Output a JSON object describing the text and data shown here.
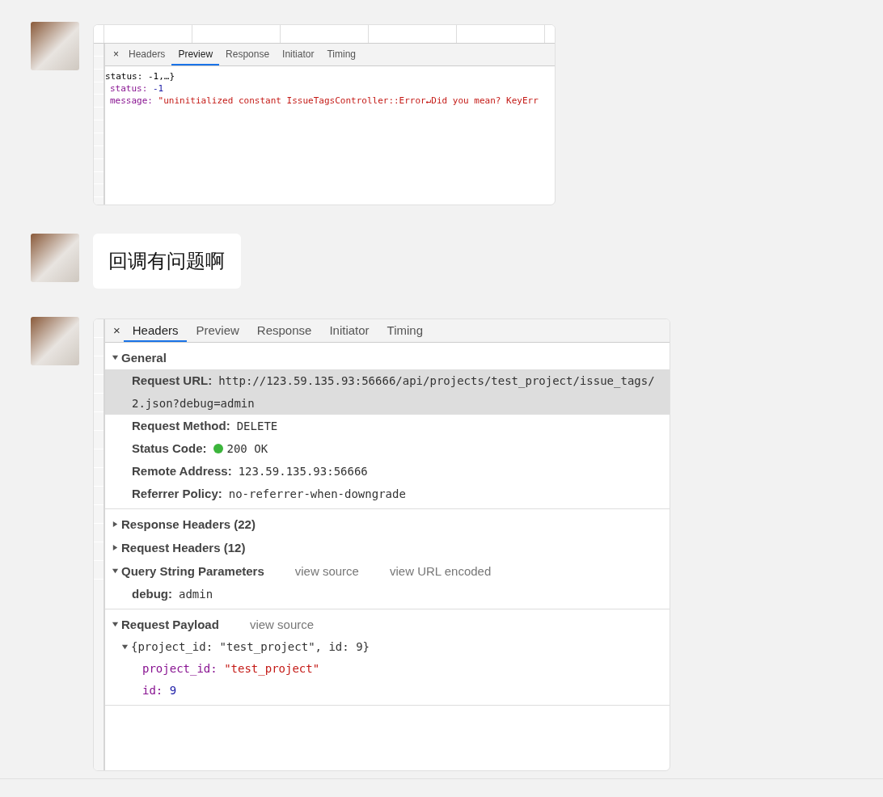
{
  "messages": [
    {
      "kind": "devtools_preview",
      "close": "×",
      "tabs": [
        {
          "label": "Headers",
          "selected": false
        },
        {
          "label": "Preview",
          "selected": true
        },
        {
          "label": "Response",
          "selected": false
        },
        {
          "label": "Initiator",
          "selected": false
        },
        {
          "label": "Timing",
          "selected": false
        }
      ],
      "root": "status: -1,…}",
      "props": [
        {
          "key": "status:",
          "value": "-1",
          "kind": "number"
        },
        {
          "key": "message:",
          "value": "\"uninitialized constant IssueTagsController::Error↵Did you mean?  KeyErr",
          "kind": "string"
        }
      ]
    },
    {
      "kind": "text",
      "text": "回调有问题啊"
    },
    {
      "kind": "devtools_headers",
      "close": "×",
      "tabs": [
        {
          "label": "Headers",
          "selected": true
        },
        {
          "label": "Preview",
          "selected": false
        },
        {
          "label": "Response",
          "selected": false
        },
        {
          "label": "Initiator",
          "selected": false
        },
        {
          "label": "Timing",
          "selected": false
        }
      ],
      "groups": [
        [
          {
            "title": "General",
            "expanded": true,
            "rows": [
              {
                "label": "Request URL:",
                "value": "http://123.59.135.93:56666/api/projects/test_project/issue_tags/2.json?debug=admin",
                "highlighted": true
              },
              {
                "label": "Request Method:",
                "value": "DELETE",
                "highlighted": false
              },
              {
                "label": "Status Code:",
                "value": "200 OK",
                "highlighted": false,
                "color": "#3cb53c"
              },
              {
                "label": "Remote Address:",
                "value": "123.59.135.93:56666",
                "highlighted": false
              },
              {
                "label": "Referrer Policy:",
                "value": "no-referrer-when-downgrade",
                "highlighted": false
              }
            ]
          }
        ],
        [
          {
            "title": "Response Headers (22)",
            "expanded": false
          },
          {
            "title": "Request Headers (12)",
            "expanded": false
          },
          {
            "title": "Query String Parameters",
            "expanded": true,
            "links": [
              "view source",
              "view URL encoded"
            ],
            "rows": [
              {
                "label": "debug:",
                "value": "admin",
                "highlighted": false
              }
            ]
          }
        ],
        [
          {
            "title": "Request Payload",
            "expanded": true,
            "links": [
              "view source"
            ],
            "tree": {
              "summary": "{project_id: \"test_project\", id: 9}",
              "expanded": true,
              "children": [
                {
                  "key": "project_id:",
                  "value": "\"test_project\"",
                  "kind": "string"
                },
                {
                  "key": "id:",
                  "value": "9",
                  "kind": "number"
                }
              ]
            }
          }
        ]
      ]
    }
  ]
}
